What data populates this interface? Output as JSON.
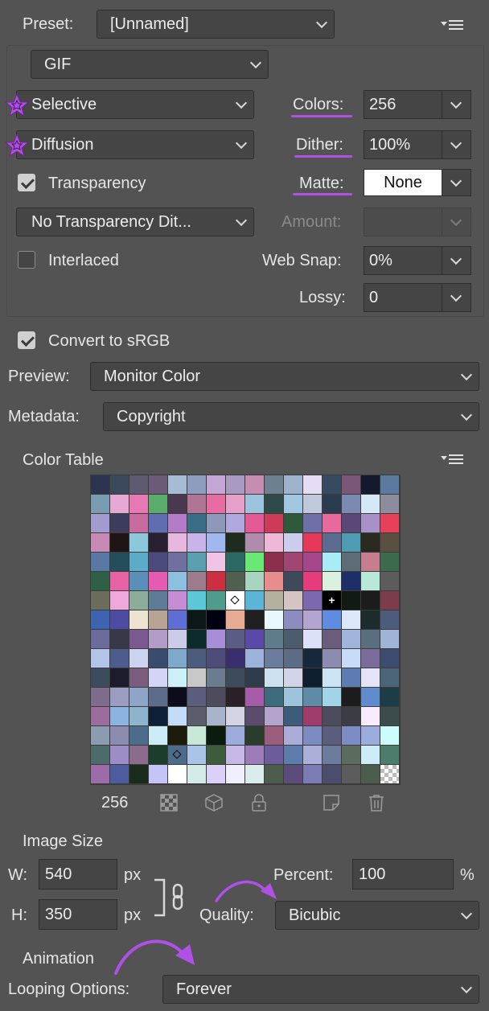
{
  "settings": {
    "preset_label": "Preset:",
    "preset_value": "[Unnamed]",
    "format_value": "GIF",
    "reduction_value": "Selective",
    "dither_algo_value": "Diffusion",
    "colors_label": "Colors:",
    "colors_value": "256",
    "dither_label": "Dither:",
    "dither_value": "100%",
    "transparency_label": "Transparency",
    "transparency_checked": true,
    "matte_label": "Matte:",
    "matte_value": "None",
    "transparency_dither_value": "No Transparency Dit...",
    "amount_label": "Amount:",
    "amount_value": "",
    "interlaced_label": "Interlaced",
    "interlaced_checked": false,
    "websnap_label": "Web Snap:",
    "websnap_value": "0%",
    "lossy_label": "Lossy:",
    "lossy_value": "0"
  },
  "srgb": {
    "label": "Convert to sRGB",
    "checked": true
  },
  "preview": {
    "label": "Preview:",
    "value": "Monitor Color"
  },
  "metadata": {
    "label": "Metadata:",
    "value": "Copyright"
  },
  "color_table": {
    "title": "Color Table",
    "count": "256",
    "swatches": [
      "#2b3550",
      "#3a4a5c",
      "#5e5b70",
      "#6b5a78",
      "#a6bcd4",
      "#8e9cc0",
      "#c3a6d4",
      "#a89ac0",
      "#c58eb0",
      "#6c8090",
      "#9fb2cc",
      "#e6dcf4",
      "#364a60",
      "#7a5678",
      "#15192e",
      "#5a7aa0",
      "#7a9cb0",
      "#e6a8d4",
      "#e678b4",
      "#5aac6a",
      "#4a3850",
      "#b07494",
      "#e86ca4",
      "#e6a0c8",
      "#9cc4dc",
      "#2e4a48",
      "#a0c8e0",
      "#c0c8dc",
      "#2a3c50",
      "#7a8ab0",
      "#d4e8f8",
      "#8c8c9c",
      "#a09cd0",
      "#3c3c5c",
      "#c86ca0",
      "#5e6eb0",
      "#b47cc8",
      "#3a6e86",
      "#8e98b8",
      "#b0a8e0",
      "#e35a96",
      "#cc3c58",
      "#2e5a3c",
      "#7070a8",
      "#e86a9c",
      "#5c4878",
      "#a890c8",
      "#e8405a",
      "#c88ab4",
      "#201414",
      "#8cc8dc",
      "#2a2034",
      "#e6b8e0",
      "#c8b4e8",
      "#a0b8f0",
      "#1e2c1e",
      "#b08cac",
      "#f0b8d8",
      "#ccccee",
      "#e63858",
      "#5c6c90",
      "#4e9cb4",
      "#2a2a20",
      "#5a5040",
      "#5a78a4",
      "#234e5a",
      "#5aacc8",
      "#4a4a7c",
      "#7070a0",
      "#5aa0b0",
      "#f0c4e4",
      "#2a6864",
      "#6ae874",
      "#8c2e4c",
      "#a04670",
      "#a6468c",
      "#a8ecf8",
      "#5e6c78",
      "#c87c90",
      "#3c6a4c",
      "#2e6048",
      "#e662a4",
      "#5a90b8",
      "#e65ab4",
      "#8cc0e0",
      "#9c7c8c",
      "#cc3040",
      "#506050",
      "#a8d4c0",
      "#e88c8c",
      "#3c4a5c",
      "#e63c7c",
      "#dcf0e0",
      "#1e2e68",
      "#b8e8d8",
      "#5c5c5c",
      "#6c6c5c",
      "#f0a8dc",
      "#8cac9c",
      "#5e7c98",
      "#c88cd4",
      "#5ac8d8",
      "#4e9c8c",
      "#ffffff",
      "#5cb4d8",
      "#b4b0a0",
      "#d4c4c4",
      "#7c68b0",
      "#000000",
      "#121a14",
      "#1c1c1c",
      "#7c3c4c",
      "#3c64b0",
      "#4c4ca4",
      "#ece4d0",
      "#b8a494",
      "#5e6ed4",
      "#0c1818",
      "#000010",
      "#e8ac94",
      "#202020",
      "#e8f8fc",
      "#8c8cc0",
      "#b4a4d0",
      "#5e8ce0",
      "#dce8f8",
      "#1c2c2c",
      "#4e5c7c",
      "#6c6c9c",
      "#383848",
      "#7c5890",
      "#b49cc8",
      "#cccce8",
      "#0c2c2c",
      "#a88ed8",
      "#5a5c84",
      "#5c48a8",
      "#5e7c8c",
      "#4c5c6c",
      "#dce0f8",
      "#6c5c7c",
      "#a0b4dc",
      "#5a6e80",
      "#a0b4d8",
      "#b4c4e8",
      "#4c5c8c",
      "#ccd4f0",
      "#3a4c6e",
      "#7ea8cc",
      "#4c5c7c",
      "#4e4c78",
      "#3a2e6e",
      "#9cb4dc",
      "#6c7c9c",
      "#5c6c84",
      "#18283c",
      "#8c8cb0",
      "#c8dcf8",
      "#7c6c9c",
      "#3c4c6e",
      "#3c4c5c",
      "#1c1c2c",
      "#7c5c7c",
      "#d4d4f4",
      "#ccf0f8",
      "#c8c8c8",
      "#6c7c90",
      "#3c4c5c",
      "#2e3c4c",
      "#cce0f0",
      "#d4d4e8",
      "#0e2030",
      "#cce4f4",
      "#5e7cb4",
      "#e4e4f4",
      "#4c6478",
      "#7e6c8c",
      "#9c9cc0",
      "#8ea4c8",
      "#5e6c8c",
      "#0c0c1c",
      "#5c5c7c",
      "#4c4c5c",
      "#2c2028",
      "#a65ca8",
      "#3c6c7c",
      "#9ec4dc",
      "#5e8ca8",
      "#a0d4e8",
      "#1c1c1c",
      "#5e8ccc",
      "#1c3c48",
      "#9c6c9c",
      "#8cb4e0",
      "#8eb4cc",
      "#0e2038",
      "#c4dcf8",
      "#5c5c6c",
      "#a8b4cc",
      "#d4d4e4",
      "#5c4c6c",
      "#b4a4cc",
      "#3c5c7c",
      "#a03c6c",
      "#4c4c5c",
      "#3c3c44",
      "#f8ecfc",
      "#3c4c4c",
      "#8c9cb0",
      "#8c8cb0",
      "#4c6c8c",
      "#ccecf8",
      "#1c1c0c",
      "#c8e8d8",
      "#0c1c0c",
      "#9cacdc",
      "#2c3c2c",
      "#9c5c7c",
      "#acacd8",
      "#7c8cc0",
      "#5c5c7c",
      "#7c8cc4",
      "#9cacdc",
      "#ccfcfc",
      "#4c6c6c",
      "#9c8cc8",
      "#8c6c8c",
      "#1c3c2c",
      "#4c6c8c",
      "#a8c4e8",
      "#3c5c3c",
      "#c8b8e8",
      "#9c7cb8",
      "#6c5c9c",
      "#5c7cac",
      "#acb0d8",
      "#6c7c9c",
      "#5c6c5c",
      "#ccecf8",
      "#4c7c6c",
      "#9c6ca8",
      "#4c5c9c",
      "#1c2c1c",
      "#c4c4f8",
      "#ffffff",
      "#d4ece8",
      "#dcd0f8",
      "#f0f0fc",
      "#dcecec",
      "#4c5c4c",
      "#5c4c7c",
      "#7c7cb4",
      "#4c4c6c",
      "#5c5c5c",
      "#4c5c4c",
      "#trans"
    ]
  },
  "image_size": {
    "title": "Image Size",
    "w_label": "W:",
    "w_value": "540",
    "h_label": "H:",
    "h_value": "350",
    "unit": "px",
    "percent_label": "Percent:",
    "percent_value": "100",
    "percent_unit": "%",
    "quality_label": "Quality:",
    "quality_value": "Bicubic"
  },
  "animation": {
    "title": "Animation",
    "looping_label": "Looping Options:",
    "looping_value": "Forever"
  },
  "accent_color": "#b150e6"
}
